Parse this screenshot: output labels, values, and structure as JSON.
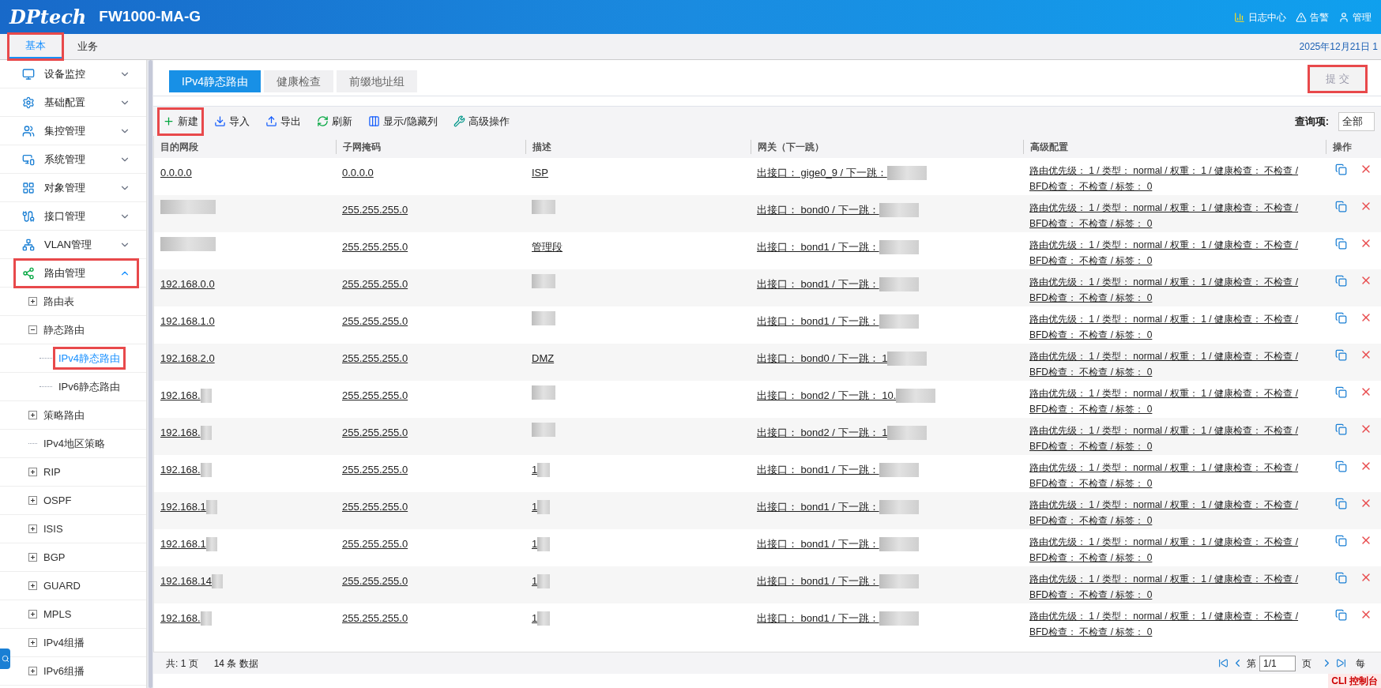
{
  "header": {
    "logo": "DPtech",
    "device": "FW1000-MA-G",
    "actions": [
      {
        "label": "日志中心"
      },
      {
        "label": "告警"
      },
      {
        "label": "管理"
      }
    ]
  },
  "top_tabs": [
    {
      "label": "基本",
      "selected": true,
      "highlighted": true
    },
    {
      "label": "业务",
      "selected": false,
      "highlighted": false
    }
  ],
  "datetime": "2025年12月21日 1",
  "sidebar": {
    "items": [
      {
        "label": "设备监控",
        "expanded": false,
        "highlighted": false
      },
      {
        "label": "基础配置",
        "expanded": false,
        "highlighted": false
      },
      {
        "label": "集控管理",
        "expanded": false,
        "highlighted": false
      },
      {
        "label": "系统管理",
        "expanded": false,
        "highlighted": false
      },
      {
        "label": "对象管理",
        "expanded": false,
        "highlighted": false
      },
      {
        "label": "接口管理",
        "expanded": false,
        "highlighted": false
      },
      {
        "label": "VLAN管理",
        "expanded": false,
        "highlighted": false
      },
      {
        "label": "路由管理",
        "expanded": true,
        "highlighted": true,
        "children": [
          {
            "label": "路由表",
            "kind": "folder",
            "expanded": false
          },
          {
            "label": "静态路由",
            "kind": "folder",
            "expanded": true,
            "children": [
              {
                "label": "IPv4静态路由",
                "selected": true,
                "highlighted": true
              },
              {
                "label": "IPv6静态路由",
                "selected": false,
                "highlighted": false
              }
            ]
          },
          {
            "label": "策略路由",
            "kind": "folder",
            "expanded": false
          },
          {
            "label": "IPv4地区策略",
            "kind": "leaf"
          },
          {
            "label": "RIP",
            "kind": "folder",
            "expanded": false
          },
          {
            "label": "OSPF",
            "kind": "folder",
            "expanded": false
          },
          {
            "label": "ISIS",
            "kind": "folder",
            "expanded": false
          },
          {
            "label": "BGP",
            "kind": "folder",
            "expanded": false
          },
          {
            "label": "GUARD",
            "kind": "folder",
            "expanded": false
          },
          {
            "label": "MPLS",
            "kind": "folder",
            "expanded": false
          },
          {
            "label": "IPv4组播",
            "kind": "folder",
            "expanded": false
          },
          {
            "label": "IPv6组播",
            "kind": "folder",
            "expanded": false
          }
        ]
      }
    ]
  },
  "content_tabs": [
    {
      "label": "IPv4静态路由",
      "selected": true
    },
    {
      "label": "健康检查",
      "selected": false
    },
    {
      "label": "前缀地址组",
      "selected": false
    }
  ],
  "submit": {
    "label": "提 交",
    "disabled": true,
    "highlighted": true
  },
  "toolbar": [
    {
      "label": "新建",
      "highlighted": true
    },
    {
      "label": "导入",
      "highlighted": false
    },
    {
      "label": "导出",
      "highlighted": false
    },
    {
      "label": "刷新",
      "highlighted": false
    },
    {
      "label": "显示/隐藏列",
      "highlighted": false
    },
    {
      "label": "高级操作",
      "highlighted": false
    }
  ],
  "query": {
    "label": "查询项:",
    "value": "全部"
  },
  "table": {
    "columns": [
      "目的网段",
      "子网掩码",
      "描述",
      "网关（下一跳）",
      "高级配置",
      "操作"
    ],
    "rows": [
      {
        "dest": {
          "text": "0.0.0.0",
          "redacted": false
        },
        "mask": "0.0.0.0",
        "desc": {
          "text": "ISP",
          "redacted": false
        },
        "gateway": {
          "text": "出接口： gige0_9 / 下一跳：",
          "redacted": true
        },
        "advanced": "路由优先级： 1 / 类型： normal / 权重： 1 / 健康检查： 不检查 / BFD检查： 不检查 / 标签： 0"
      },
      {
        "dest": {
          "redacted": true
        },
        "mask": "255.255.255.0",
        "desc": {
          "redacted": true
        },
        "gateway": {
          "text": "出接口： bond0 / 下一跳：",
          "redacted": true
        },
        "advanced": "路由优先级： 1 / 类型： normal / 权重： 1 / 健康检查： 不检查 / BFD检查： 不检查 / 标签： 0"
      },
      {
        "dest": {
          "redacted": true
        },
        "mask": "255.255.255.0",
        "desc": {
          "text": "管理段",
          "redacted": false
        },
        "gateway": {
          "text": "出接口： bond1 / 下一跳：",
          "redacted": true
        },
        "advanced": "路由优先级： 1 / 类型： normal / 权重： 1 / 健康检查： 不检查 / BFD检查： 不检查 / 标签： 0"
      },
      {
        "dest": {
          "text": "192.168.0.0",
          "redacted": false
        },
        "mask": "255.255.255.0",
        "desc": {
          "redacted": true
        },
        "gateway": {
          "text": "出接口： bond1 / 下一跳：",
          "redacted": true
        },
        "advanced": "路由优先级： 1 / 类型： normal / 权重： 1 / 健康检查： 不检查 / BFD检查： 不检查 / 标签： 0"
      },
      {
        "dest": {
          "text": "192.168.1.0",
          "redacted": false
        },
        "mask": "255.255.255.0",
        "desc": {
          "redacted": true
        },
        "gateway": {
          "text": "出接口： bond1 / 下一跳：",
          "redacted": true
        },
        "advanced": "路由优先级： 1 / 类型： normal / 权重： 1 / 健康检查： 不检查 / BFD检查： 不检查 / 标签： 0"
      },
      {
        "dest": {
          "text": "192.168.2.0",
          "redacted": false
        },
        "mask": "255.255.255.0",
        "desc": {
          "text": "DMZ",
          "redacted": false
        },
        "gateway": {
          "text": "出接口： bond0 / 下一跳： 1",
          "redacted": true
        },
        "advanced": "路由优先级： 1 / 类型： normal / 权重： 1 / 健康检查： 不检查 / BFD检查： 不检查 / 标签： 0"
      },
      {
        "dest": {
          "text": "192.168.",
          "redacted": true
        },
        "mask": "255.255.255.0",
        "desc": {
          "redacted": true
        },
        "gateway": {
          "text": "出接口： bond2 / 下一跳： 10.",
          "redacted": true
        },
        "advanced": "路由优先级： 1 / 类型： normal / 权重： 1 / 健康检查： 不检查 / BFD检查： 不检查 / 标签： 0"
      },
      {
        "dest": {
          "text": "192.168.",
          "redacted": true
        },
        "mask": "255.255.255.0",
        "desc": {
          "redacted": true
        },
        "gateway": {
          "text": "出接口： bond2 / 下一跳： 1",
          "redacted": true
        },
        "advanced": "路由优先级： 1 / 类型： normal / 权重： 1 / 健康检查： 不检查 / BFD检查： 不检查 / 标签： 0"
      },
      {
        "dest": {
          "text": "192.168.",
          "redacted": true
        },
        "mask": "255.255.255.0",
        "desc": {
          "text": "1",
          "redacted": true
        },
        "gateway": {
          "text": "出接口： bond1 / 下一跳：",
          "redacted": true
        },
        "advanced": "路由优先级： 1 / 类型： normal / 权重： 1 / 健康检查： 不检查 / BFD检查： 不检查 / 标签： 0"
      },
      {
        "dest": {
          "text": "192.168.1",
          "redacted": true
        },
        "mask": "255.255.255.0",
        "desc": {
          "text": "1",
          "redacted": true
        },
        "gateway": {
          "text": "出接口： bond1 / 下一跳：",
          "redacted": true
        },
        "advanced": "路由优先级： 1 / 类型： normal / 权重： 1 / 健康检查： 不检查 / BFD检查： 不检查 / 标签： 0"
      },
      {
        "dest": {
          "text": "192.168.1",
          "redacted": true
        },
        "mask": "255.255.255.0",
        "desc": {
          "text": "1",
          "redacted": true
        },
        "gateway": {
          "text": "出接口： bond1 / 下一跳：",
          "redacted": true
        },
        "advanced": "路由优先级： 1 / 类型： normal / 权重： 1 / 健康检查： 不检查 / BFD检查： 不检查 / 标签： 0"
      },
      {
        "dest": {
          "text": "192.168.14",
          "redacted": true
        },
        "mask": "255.255.255.0",
        "desc": {
          "text": "1",
          "redacted": true
        },
        "gateway": {
          "text": "出接口： bond1 / 下一跳：",
          "redacted": true
        },
        "advanced": "路由优先级： 1 / 类型： normal / 权重： 1 / 健康检查： 不检查 / BFD检查： 不检查 / 标签： 0"
      },
      {
        "dest": {
          "text": "192.168.",
          "redacted": true
        },
        "mask": "255.255.255.0",
        "desc": {
          "text": "1",
          "redacted": true
        },
        "gateway": {
          "text": "出接口： bond1 / 下一跳：",
          "redacted": true
        },
        "advanced": "路由优先级： 1 / 类型： normal / 权重： 1 / 健康检查： 不检查 / BFD检查： 不检查 / 标签： 0"
      }
    ]
  },
  "footer": {
    "pages": "共: 1 页",
    "count": "14 条 数据",
    "page_prefix": "第",
    "page_select": "1/1",
    "page_suffix": "页",
    "per_page": "每"
  },
  "cli_badge": "CLI 控制台"
}
